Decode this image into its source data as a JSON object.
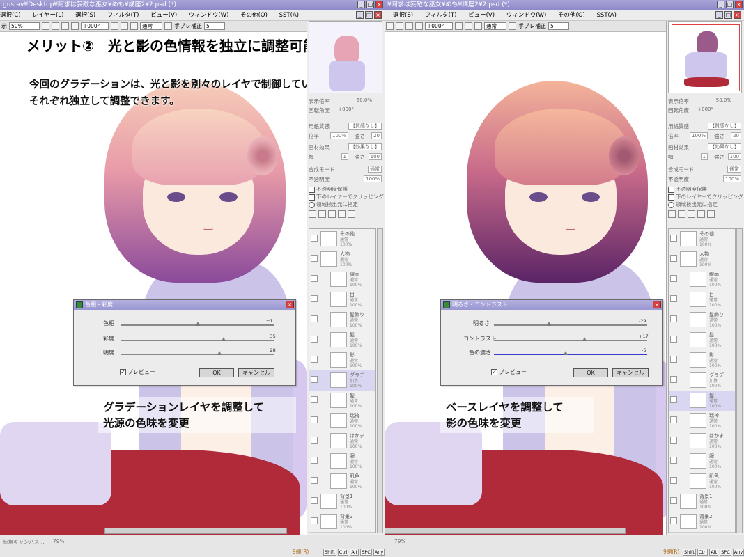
{
  "left": {
    "window_title": "gustav¥Desktop¥阿求は妄敵な巫女¥めも¥講座2¥2.psd (*)",
    "menu": [
      "選択(C)",
      "レイヤー(L)",
      "選択(S)",
      "フィルタ(T)",
      "ビュー(V)",
      "ウィンドウ(W)",
      "その他(O)",
      "SST(A)"
    ],
    "toolbar": {
      "label_prefix": "示",
      "zoom": "50%",
      "angle": "+000°",
      "mode": "通常",
      "stabilizer_label": "手ブレ補正",
      "stabilizer": "5"
    },
    "headline": "メリット②　光と影の色情報を独立に調整可能",
    "desc_line1": "今回のグラデーションは、光と影を別々のレイヤで制御しているため",
    "desc_line2": "それぞれ独立して調整できます。",
    "caption_line1": "グラデーションレイヤを調整して",
    "caption_line2": "光源の色味を変更",
    "status_text": "新規キャンバス...",
    "zoom_status": "79%",
    "status_extra": "9縮(R)",
    "dialog": {
      "title": "色相・彩度",
      "sliders": [
        {
          "label": "色相",
          "value": "+1",
          "pos": 0.5
        },
        {
          "label": "彩度",
          "value": "+35",
          "pos": 0.67
        },
        {
          "label": "明度",
          "value": "+28",
          "pos": 0.64
        }
      ],
      "preview_label": "プレビュー",
      "ok": "OK",
      "cancel": "キャンセル"
    }
  },
  "right": {
    "window_title": "¥阿求は妄敵な巫女¥めも¥講座2¥2.psd (*)",
    "menu": [
      "選択(S)",
      "フィルタ(T)",
      "ビュー(V)",
      "ウィンドウ(W)",
      "その他(O)",
      "SST(A)"
    ],
    "toolbar": {
      "angle": "+000°",
      "mode": "通常",
      "stabilizer_label": "手ブレ補正",
      "stabilizer": "5"
    },
    "caption_line1": "ベースレイヤを調整して",
    "caption_line2": "影の色味を変更",
    "zoom_status": "79%",
    "status_extra": "9縮(R)",
    "dialog": {
      "title": "明るさ・コントラスト",
      "sliders": [
        {
          "label": "明るさ",
          "value": "-29",
          "pos": 0.36
        },
        {
          "label": "コントラスト",
          "value": "+17",
          "pos": 0.59
        },
        {
          "label": "色の濃さ",
          "value": "-6",
          "pos": 0.47
        }
      ],
      "preview_label": "プレビュー",
      "ok": "OK",
      "cancel": "キャンセル"
    }
  },
  "panel": {
    "zoom_label": "表示倍率",
    "zoom_value": "50.0%",
    "rotation_label": "回転角度",
    "rotation_value": "+000°",
    "paper_label": "用紙質感",
    "paper_value": "【質感なし】",
    "paper_scale_label": "倍率",
    "paper_scale_value": "100%",
    "paper_strength_label": "強さ",
    "paper_strength_value": "20",
    "effect_label": "画材効果",
    "effect_value": "【効果なし】",
    "effect_width_label": "幅",
    "effect_width_value": "1",
    "effect_strength_label": "強さ",
    "effect_strength_value": "100",
    "blend_label": "合成モード",
    "blend_value": "通常",
    "opacity_label": "不透明度",
    "opacity_value": "100%",
    "protect_label": "不透明度保護",
    "clip_label": "下のレイヤーでクリッピング",
    "ref_label": "領域検出元に指定",
    "left_layers": [
      {
        "name": "その他",
        "mode": "通常",
        "opacity": "100%"
      },
      {
        "name": "人物",
        "mode": "通常",
        "opacity": "100%"
      },
      {
        "name": "線画",
        "mode": "通常",
        "opacity": "100%"
      },
      {
        "name": "目",
        "mode": "通常",
        "opacity": "100%"
      },
      {
        "name": "髪飾り",
        "mode": "通常",
        "opacity": "100%"
      },
      {
        "name": "髪",
        "mode": "通常",
        "opacity": "100%"
      },
      {
        "name": "影",
        "mode": "通常",
        "opacity": "100%"
      },
      {
        "name": "グラデ",
        "mode": "加算",
        "opacity": "100%"
      },
      {
        "name": "髪",
        "mode": "通常",
        "opacity": "100%"
      },
      {
        "name": "瑞袴",
        "mode": "通常",
        "opacity": "100%"
      },
      {
        "name": "はかま",
        "mode": "通常",
        "opacity": "100%"
      },
      {
        "name": "服",
        "mode": "通常",
        "opacity": "100%"
      },
      {
        "name": "肌色",
        "mode": "通常",
        "opacity": "100%"
      },
      {
        "name": "背景1",
        "mode": "通常",
        "opacity": "100%"
      },
      {
        "name": "背景2",
        "mode": "通常",
        "opacity": "100%"
      }
    ],
    "right_layers": [
      {
        "name": "その他",
        "mode": "通常",
        "opacity": "100%"
      },
      {
        "name": "人物",
        "mode": "通常",
        "opacity": "100%"
      },
      {
        "name": "線画",
        "mode": "通常",
        "opacity": "100%"
      },
      {
        "name": "目",
        "mode": "通常",
        "opacity": "100%"
      },
      {
        "name": "髪飾り",
        "mode": "通常",
        "opacity": "100%"
      },
      {
        "name": "髪",
        "mode": "通常",
        "opacity": "100%"
      },
      {
        "name": "影",
        "mode": "通常",
        "opacity": "100%"
      },
      {
        "name": "グラデ",
        "mode": "加算",
        "opacity": "100%"
      },
      {
        "name": "髪",
        "mode": "通常",
        "opacity": "100%"
      },
      {
        "name": "瑞袴",
        "mode": "通常",
        "opacity": "100%"
      },
      {
        "name": "はかま",
        "mode": "通常",
        "opacity": "100%"
      },
      {
        "name": "服",
        "mode": "通常",
        "opacity": "100%"
      },
      {
        "name": "肌色",
        "mode": "通常",
        "opacity": "100%"
      },
      {
        "name": "背景1",
        "mode": "通常",
        "opacity": "100%"
      },
      {
        "name": "背景2",
        "mode": "通常",
        "opacity": "100%"
      }
    ]
  },
  "keys": [
    "Shift",
    "Ctrl",
    "Alt",
    "SPC",
    "Any"
  ],
  "colors": {
    "titlebar": "#9a96d2",
    "hair_top_left": "#f4c4b0",
    "hair_bottom_left": "#7a3a8e",
    "hair_top_right": "#f2b39a",
    "hair_bottom_right": "#5a2466",
    "kimono": "#cbc3e8",
    "hakama": "#b02a3a"
  }
}
